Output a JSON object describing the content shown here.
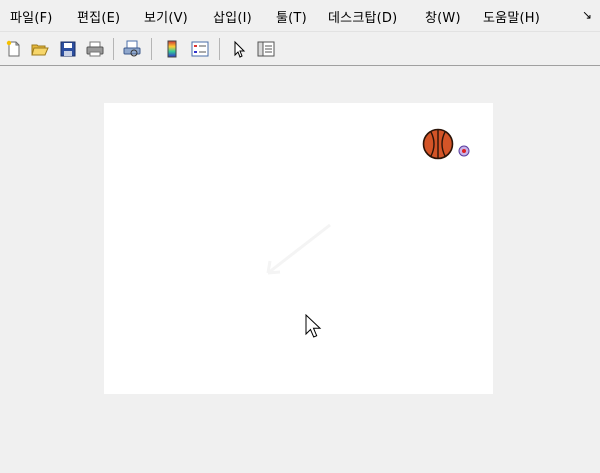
{
  "menu": {
    "file": "파일(F)",
    "edit": "편집(E)",
    "view": "보기(V)",
    "insert": "삽입(I)",
    "tools": "툴(T)",
    "desktop": "데스크탑(D)",
    "window": "창(W)",
    "help": "도움말(H)",
    "overflow": "↘"
  },
  "toolbar_icons": [
    "new-file-icon",
    "open-folder-icon",
    "save-icon",
    "print-icon",
    "print-preview-icon",
    "colorbar-icon",
    "legend-icon",
    "select-pointer-icon",
    "property-inspector-icon"
  ],
  "colors": {
    "background": "#f0f0f0",
    "canvas": "#ffffff",
    "ball": "#d35427"
  }
}
